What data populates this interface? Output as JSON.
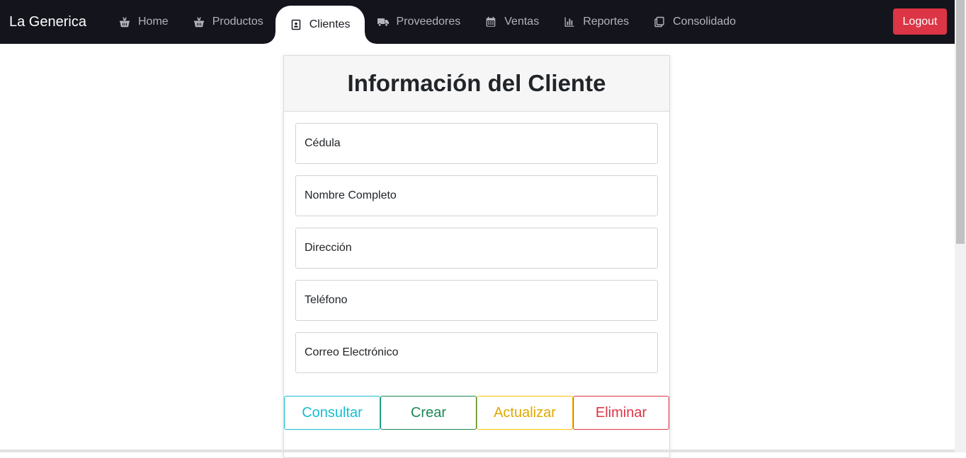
{
  "navbar": {
    "brand": "La Generica",
    "items": [
      {
        "label": "Home",
        "icon": "basket-icon",
        "active": false
      },
      {
        "label": "Productos",
        "icon": "basket-icon",
        "active": false
      },
      {
        "label": "Clientes",
        "icon": "contact-card-icon",
        "active": true
      },
      {
        "label": "Proveedores",
        "icon": "truck-icon",
        "active": false
      },
      {
        "label": "Ventas",
        "icon": "calendar-icon",
        "active": false
      },
      {
        "label": "Reportes",
        "icon": "bar-chart-icon",
        "active": false
      },
      {
        "label": "Consolidado",
        "icon": "copy-icon",
        "active": false
      }
    ],
    "logout_label": "Logout"
  },
  "form": {
    "title": "Información del Cliente",
    "fields": [
      {
        "placeholder": "Cédula",
        "value": ""
      },
      {
        "placeholder": "Nombre Completo",
        "value": ""
      },
      {
        "placeholder": "Dirección",
        "value": ""
      },
      {
        "placeholder": "Teléfono",
        "value": ""
      },
      {
        "placeholder": "Correo Electrónico",
        "value": ""
      }
    ],
    "buttons": {
      "consultar": "Consultar",
      "crear": "Crear",
      "actualizar": "Actualizar",
      "eliminar": "Eliminar"
    }
  },
  "colors": {
    "navbar_bg": "#14141c",
    "logout": "#dc3545",
    "info": "#17bcd2",
    "success": "#198754",
    "warning": "#ffc107",
    "danger": "#dc3545"
  }
}
